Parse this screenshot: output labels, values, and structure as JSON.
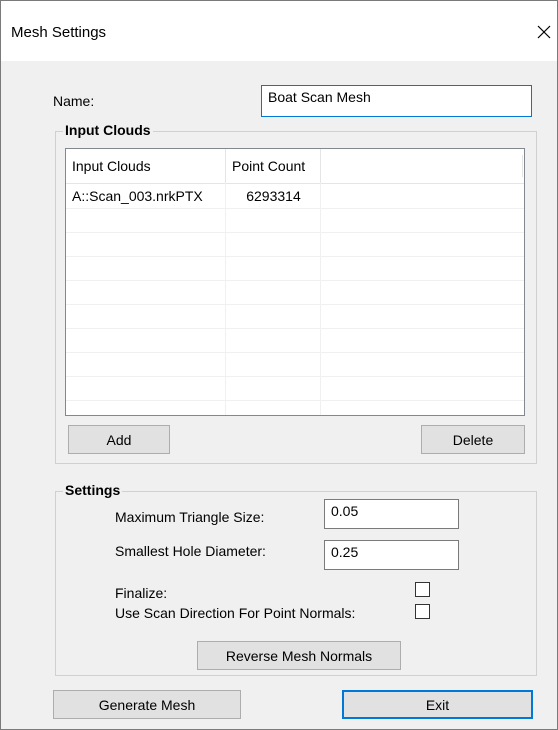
{
  "window": {
    "title": "Mesh Settings",
    "close_glyph": "✕"
  },
  "name_field": {
    "label": "Name:",
    "value": "Boat Scan Mesh"
  },
  "input_clouds": {
    "group_title": "Input Clouds",
    "columns": [
      "Input Clouds",
      "Point Count"
    ],
    "rows": [
      {
        "name": "A::Scan_003.nrkPTX",
        "point_count": "6293314"
      }
    ],
    "add_label": "Add",
    "delete_label": "Delete"
  },
  "settings": {
    "group_title": "Settings",
    "max_triangle_label": "Maximum Triangle Size:",
    "max_triangle_value": "0.05",
    "smallest_hole_label": "Smallest Hole Diameter:",
    "smallest_hole_value": "0.25",
    "finalize_label": "Finalize:",
    "finalize_checked": false,
    "scan_direction_label": "Use Scan Direction For Point Normals:",
    "scan_direction_checked": false,
    "reverse_normals_label": "Reverse Mesh Normals"
  },
  "footer": {
    "generate_label": "Generate Mesh",
    "exit_label": "Exit"
  }
}
